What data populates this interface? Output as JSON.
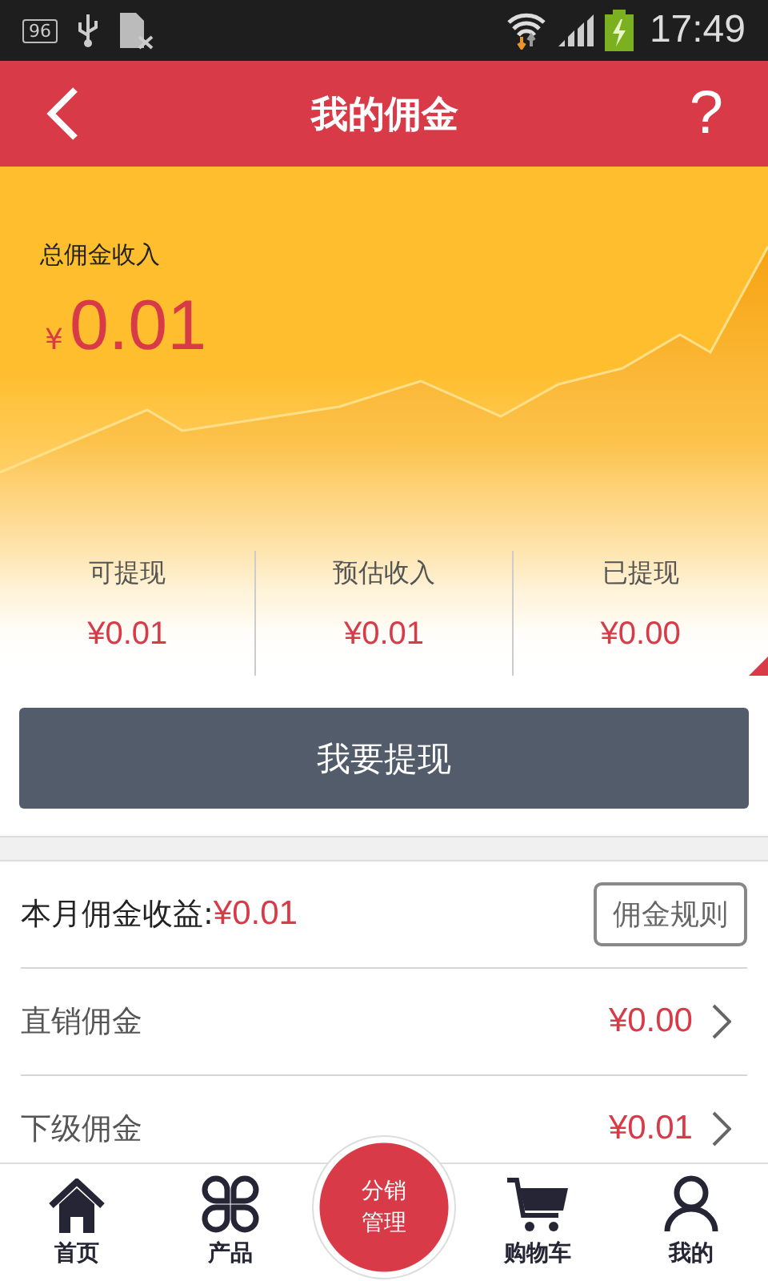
{
  "status_bar": {
    "notification": "96",
    "time": "17:49"
  },
  "header": {
    "title": "我的佣金",
    "help": "?"
  },
  "summary": {
    "label": "总佣金收入",
    "currency": "¥",
    "amount": "0.01",
    "stats": [
      {
        "label": "可提现",
        "value": "¥0.01"
      },
      {
        "label": "预估收入",
        "value": "¥0.01"
      },
      {
        "label": "已提现",
        "value": "¥0.00"
      }
    ]
  },
  "withdraw_button": "我要提现",
  "monthly": {
    "label": "本月佣金收益:",
    "value": "¥0.01",
    "rules_button": "佣金规则"
  },
  "rows": [
    {
      "label": "直销佣金",
      "value": "¥0.00"
    },
    {
      "label": "下级佣金",
      "value": "¥0.01"
    }
  ],
  "nav": [
    {
      "kind": "home",
      "label": "首页",
      "selected": false
    },
    {
      "kind": "products",
      "label": "产品",
      "selected": false
    },
    {
      "kind": "center",
      "label": "分销管理",
      "selected": false
    },
    {
      "kind": "cart",
      "label": "购物车",
      "selected": false
    },
    {
      "kind": "profile",
      "label": "我的",
      "selected": false
    }
  ]
}
